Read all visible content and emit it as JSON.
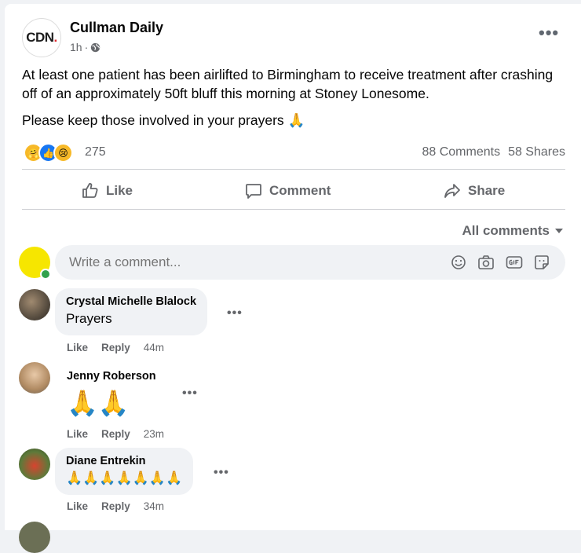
{
  "post": {
    "logo_text": "CDN",
    "logo_dot": ".",
    "page_name": "Cullman Daily",
    "time": "1h",
    "separator": "·",
    "body_p1": "At least one patient has been airlifted to Birmingham to receive treatment after crashing off of an approximately 50ft bluff this morning at Stoney Lonesome.",
    "body_p2": "Please keep those involved in your prayers",
    "body_p2_emoji": "🙏",
    "reaction_count": "275",
    "comments_count": "88 Comments",
    "shares_count": "58 Shares",
    "reactions": [
      {
        "icon": "care-reaction-icon",
        "color": "#f7b928",
        "glyph": "🤗"
      },
      {
        "icon": "like-reaction-icon",
        "color": "#1877f2",
        "glyph": "👍"
      },
      {
        "icon": "sad-reaction-icon",
        "color": "#f7b928",
        "glyph": "😢"
      }
    ]
  },
  "actions": {
    "like": "Like",
    "comment": "Comment",
    "share": "Share"
  },
  "comments_section": {
    "sort_label": "All comments",
    "composer_placeholder": "Write a comment..."
  },
  "comments": [
    {
      "name": "Crystal Michelle Blalock",
      "text": "Prayers",
      "like": "Like",
      "reply": "Reply",
      "time": "44m"
    },
    {
      "name": "Jenny Roberson",
      "text": "🙏🙏",
      "like": "Like",
      "reply": "Reply",
      "time": "23m"
    },
    {
      "name": "Diane Entrekin",
      "text": "🙏🙏🙏🙏🙏🙏🙏",
      "like": "Like",
      "reply": "Reply",
      "time": "34m"
    }
  ],
  "colors": {
    "brand_red": "#e0282e",
    "like_blue": "#1877f2",
    "muted_text": "#65676b",
    "online_green": "#31a24c",
    "my_avatar_yellow": "#f6e600"
  }
}
